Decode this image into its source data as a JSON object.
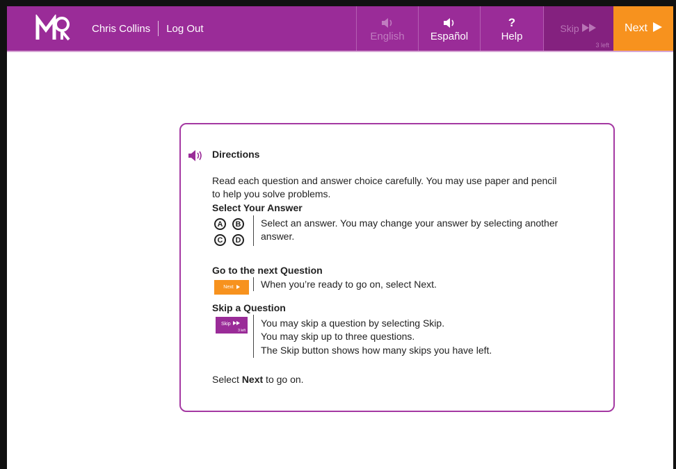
{
  "header": {
    "user_name": "Chris Collins",
    "logout_label": "Log Out",
    "english_label": "English",
    "espanol_label": "Español",
    "help_label": "Help",
    "help_symbol": "?",
    "skip_label": "Skip",
    "skip_count": "3 left",
    "next_label": "Next",
    "brand_color": "#9a2c98",
    "next_color": "#f7921e"
  },
  "directions": {
    "title": "Directions",
    "intro_line1": "Read each question and answer choice carefully. You may use paper and pencil",
    "intro_line2": "to help you solve problems.",
    "select_heading": "Select Your Answer",
    "select_text1": "Select an answer. You may change your answer by selecting another",
    "select_text2": "answer.",
    "choice_a": "A",
    "choice_b": "B",
    "choice_c": "C",
    "choice_d": "D",
    "next_heading": "Go to the next Question",
    "next_text": "When you’re ready to go on, select Next.",
    "mini_next_label": "Next",
    "skip_heading": "Skip a Question",
    "skip_text1": "You may skip a question by selecting Skip.",
    "skip_text2": "You may skip up to three questions.",
    "skip_text3": "The Skip button shows how many skips you have left.",
    "mini_skip_label": "Skip",
    "mini_skip_count": "3 left",
    "footer_prefix": "Select ",
    "footer_bold": "Next",
    "footer_suffix": " to go on."
  }
}
